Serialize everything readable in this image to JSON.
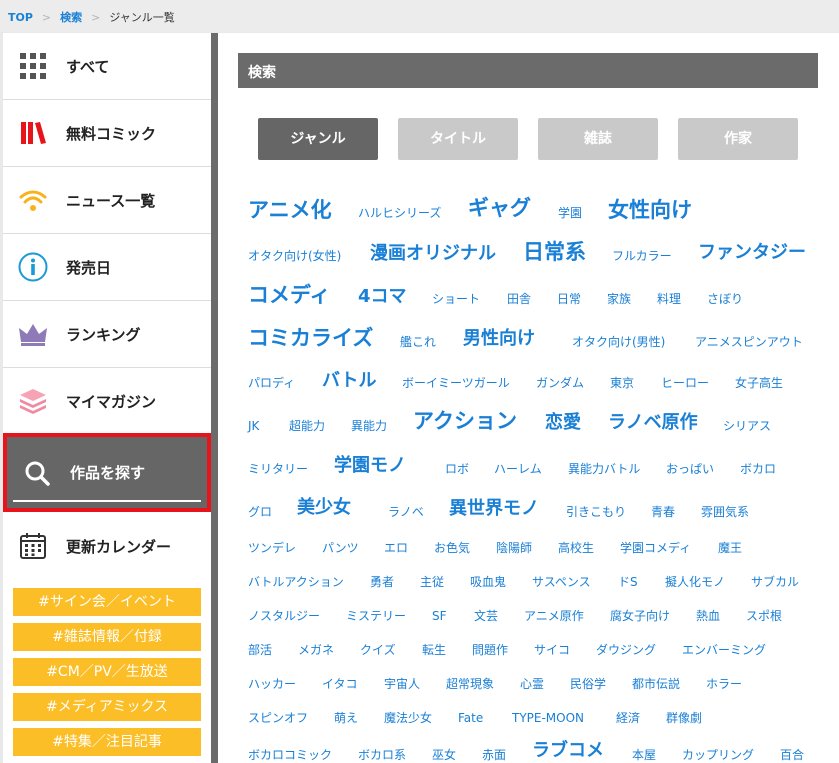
{
  "breadcrumb": {
    "top": "TOP",
    "search": "検索",
    "current": "ジャンル一覧"
  },
  "sidebar": {
    "items": [
      {
        "label": "すべて",
        "icon": "grid-icon"
      },
      {
        "label": "無料コミック",
        "icon": "books-icon"
      },
      {
        "label": "ニュース一覧",
        "icon": "wifi-icon"
      },
      {
        "label": "発売日",
        "icon": "info-icon"
      },
      {
        "label": "ランキング",
        "icon": "crown-icon"
      },
      {
        "label": "マイマガジン",
        "icon": "stack-icon"
      },
      {
        "label": "作品を探す",
        "icon": "search-icon"
      },
      {
        "label": "更新カレンダー",
        "icon": "calendar-icon"
      }
    ],
    "tags": [
      "#サイン会／イベント",
      "#雑誌情報／付録",
      "#CM／PV／生放送",
      "#メディアミックス",
      "#特集／注目記事"
    ]
  },
  "main": {
    "header": "検索",
    "tabs": [
      "ジャンル",
      "タイトル",
      "雑誌",
      "作家"
    ],
    "genres": [
      "アニメ化",
      "ハルヒシリーズ",
      "ギャグ",
      "学園",
      "女性向け",
      "オタク向け(女性)",
      "漫画オリジナル",
      "日常系",
      "フルカラー",
      "ファンタジー",
      "コメディ",
      "4コマ",
      "ショート",
      "田舎",
      "日常",
      "家族",
      "料理",
      "さぼり",
      "コミカライズ",
      "艦これ",
      "男性向け",
      "オタク向け(男性)",
      "アニメスピンアウト",
      "パロディ",
      "バトル",
      "ボーイミーツガール",
      "ガンダム",
      "東京",
      "ヒーロー",
      "女子高生",
      "JK",
      "超能力",
      "異能力",
      "アクション",
      "恋愛",
      "ラノベ原作",
      "シリアス",
      "ミリタリー",
      "学園モノ",
      "ロボ",
      "ハーレム",
      "異能力バトル",
      "おっぱい",
      "ボカロ",
      "グロ",
      "美少女",
      "ラノベ",
      "異世界モノ",
      "引きこもり",
      "青春",
      "雰囲気系",
      "ツンデレ",
      "パンツ",
      "エロ",
      "お色気",
      "陰陽師",
      "高校生",
      "学園コメディ",
      "魔王",
      "バトルアクション",
      "勇者",
      "主従",
      "吸血鬼",
      "サスペンス",
      "ドS",
      "擬人化モノ",
      "サブカル",
      "ノスタルジー",
      "ミステリー",
      "SF",
      "文芸",
      "アニメ原作",
      "腐女子向け",
      "熱血",
      "スポ根",
      "部活",
      "メガネ",
      "クイズ",
      "転生",
      "問題作",
      "サイコ",
      "ダウジング",
      "エンバーミング",
      "ハッカー",
      "イタコ",
      "宇宙人",
      "超常現象",
      "心霊",
      "民俗学",
      "都市伝説",
      "ホラー",
      "スピンオフ",
      "萌え",
      "魔法少女",
      "Fate",
      "TYPE-MOON",
      "経済",
      "群像劇",
      "ボカロコミック",
      "ボカロ系",
      "巫女",
      "赤面",
      "ラブコメ",
      "本屋",
      "カップリング",
      "百合"
    ]
  },
  "colors": {
    "link": "#1a80d6",
    "tag": "#fbbe27",
    "active_border": "#e8141b",
    "header": "#6b6b6b"
  }
}
